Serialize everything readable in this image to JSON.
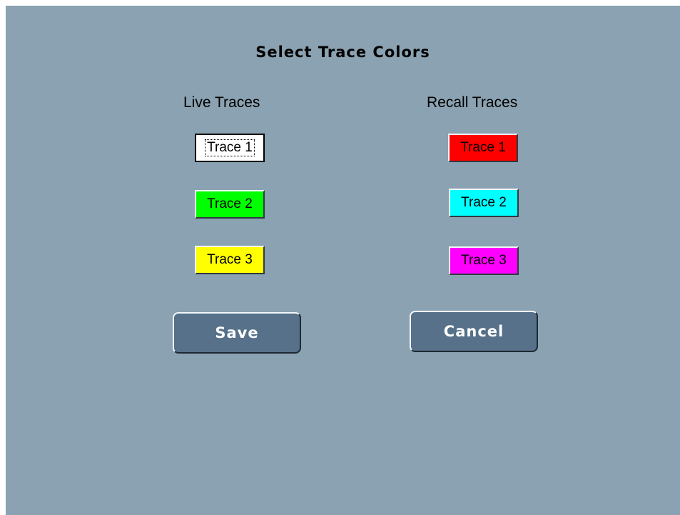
{
  "dialog": {
    "title": "Select Trace Colors"
  },
  "live": {
    "heading": "Live Traces",
    "traces": [
      {
        "label": "Trace 1",
        "color": "#ffffff",
        "selected": true
      },
      {
        "label": "Trace 2",
        "color": "#00ff00",
        "selected": false
      },
      {
        "label": "Trace 3",
        "color": "#ffff00",
        "selected": false
      }
    ]
  },
  "recall": {
    "heading": "Recall Traces",
    "traces": [
      {
        "label": "Trace 1",
        "color": "#ff0000",
        "selected": false
      },
      {
        "label": "Trace 2",
        "color": "#00ffff",
        "selected": false
      },
      {
        "label": "Trace 3",
        "color": "#ff00ff",
        "selected": false
      }
    ]
  },
  "buttons": {
    "save_label": "Save",
    "cancel_label": "Cancel"
  }
}
